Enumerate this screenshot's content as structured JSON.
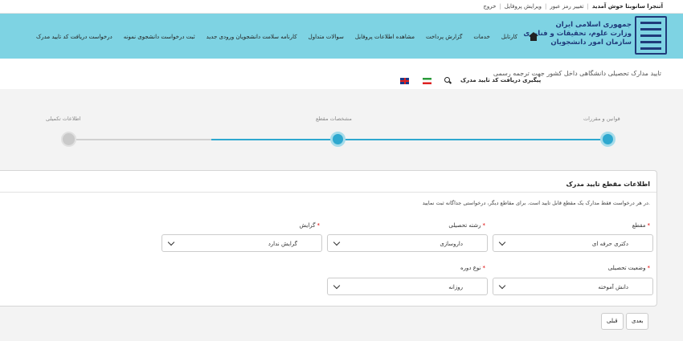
{
  "topbar": {
    "welcome": "آتنجرا سانوبتا خوش آمدید",
    "links": [
      "تغییر رمز عبور",
      "ویرایش پروفایل",
      "خروج"
    ],
    "separator": "|"
  },
  "logo": {
    "line1": "جمهوری اسلامی ایران",
    "line2": "وزارت علوم، تحقیقات و فناوری",
    "line3": "سازمان امور دانشجویان"
  },
  "nav": {
    "items": [
      "کارتابل",
      "خدمات",
      "گزارش پرداخت",
      "مشاهده اطلاعات پروفایل",
      "سوالات متداول",
      "کارنامه سلامت دانشجویان ورودی جدید",
      "ثبت درخواست دانشجوی نمونه",
      "درخواست دریافت کد تایید مدرک"
    ]
  },
  "page": {
    "title": "تایید مدارک تحصیلی دانشگاهی داخل کشور جهت ترجمه رسمی",
    "track_link": "پیگیری دریافت کد تایید مدرک"
  },
  "stepper": {
    "steps": [
      {
        "label": "قوانین و مقررات",
        "state": "active"
      },
      {
        "label": "مشخصات مقطع",
        "state": "active"
      },
      {
        "label": "اطلاعات تکمیلی",
        "state": "inactive"
      }
    ],
    "active_color": "#2ea8cf",
    "inactive_color": "#c9c9c9"
  },
  "form": {
    "title": "اطلاعات مقطع تایید مدرک",
    "note": "در هر درخواست فقط مدارک یک مقطع قابل تایید است. برای مقاطع دیگر، درخواستی جداگانه ثبت نمایید.",
    "fields": {
      "degree": {
        "label": "مقطع",
        "value": "دکتری حرفه ای"
      },
      "major": {
        "label": "رشته تحصیلی",
        "value": "داروسازی"
      },
      "orientation": {
        "label": "گرایش",
        "value": "گرایش ندارد"
      },
      "status": {
        "label": "وضعیت تحصیلی",
        "value": "دانش آموخته"
      },
      "period": {
        "label": "نوع دوره",
        "value": "روزانه"
      }
    },
    "required_mark": "*"
  },
  "buttons": {
    "next": "بعدی",
    "prev": "قبلی"
  }
}
